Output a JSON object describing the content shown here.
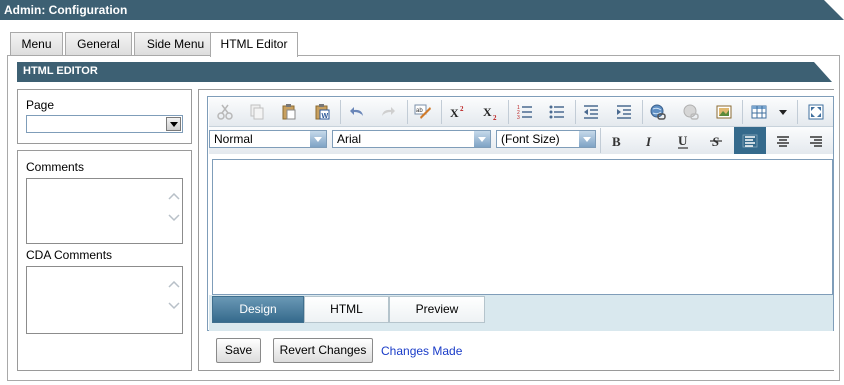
{
  "window": {
    "title": "Admin: Configuration"
  },
  "tabs": [
    {
      "label": "Menu",
      "active": false
    },
    {
      "label": "General",
      "active": false
    },
    {
      "label": "Side Menu",
      "active": false
    },
    {
      "label": "HTML Editor",
      "active": true
    }
  ],
  "section": {
    "title": "HTML EDITOR"
  },
  "left": {
    "page_label": "Page",
    "page_value": "",
    "comments_label": "Comments",
    "cda_comments_label": "CDA Comments"
  },
  "toolbar": {
    "format_block": "Normal",
    "font_name": "Arial",
    "font_size": "(Font Size)"
  },
  "modes": {
    "design": "Design",
    "html": "HTML",
    "preview": "Preview",
    "active": "Design"
  },
  "actions": {
    "save": "Save",
    "revert": "Revert Changes",
    "status": "Changes Made"
  },
  "colors": {
    "header_bar": "#3d6073",
    "active_mode": "#3f6f8e",
    "link": "#1a3cc8"
  }
}
